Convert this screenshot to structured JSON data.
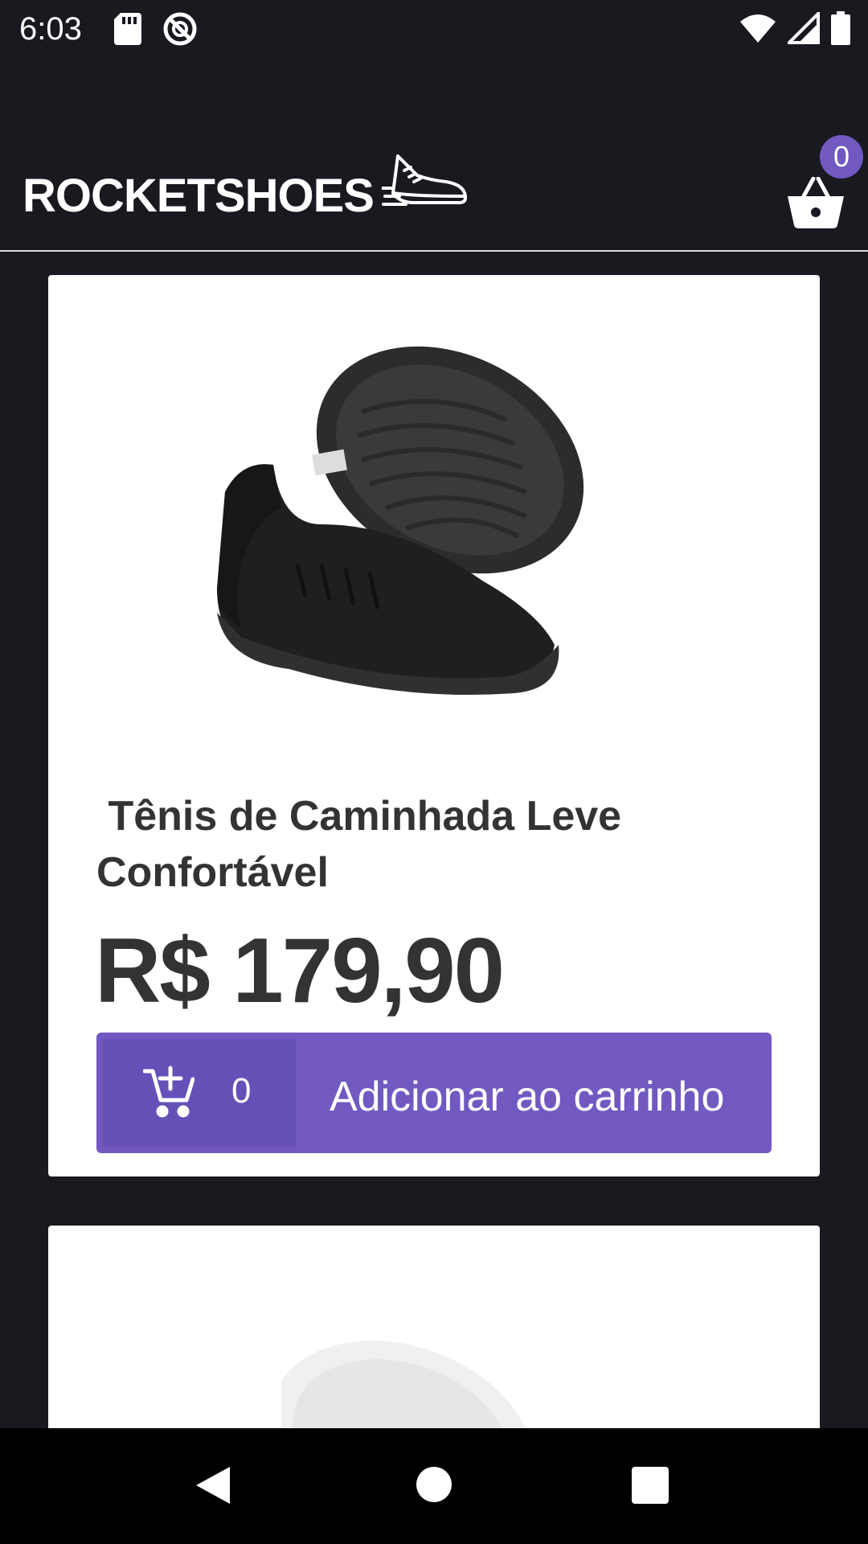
{
  "status_bar": {
    "time": "6:03",
    "icons": [
      "sd-card-icon",
      "no-ads-icon",
      "wifi-icon",
      "signal-icon",
      "battery-icon"
    ]
  },
  "header": {
    "logo_text": "ROCKETSHOES",
    "logo_icon": "running-shoe-icon",
    "cart_icon": "basket-icon",
    "cart_count": "0"
  },
  "products": [
    {
      "title": " Tênis de Caminhada Leve Confortável",
      "price": "R$ 179,90",
      "amount": "0",
      "button_label": "Adicionar ao carrinho",
      "image": "black-sneaker-image"
    },
    {
      "image": "white-sneaker-image"
    }
  ],
  "navigation": {
    "back_icon": "back-triangle-icon",
    "home_icon": "home-circle-icon",
    "recent_icon": "recent-apps-square-icon"
  },
  "colors": {
    "background": "#191920",
    "accent": "#7159c1",
    "accent_dark": "#6550b7",
    "text_dark": "#333333"
  }
}
